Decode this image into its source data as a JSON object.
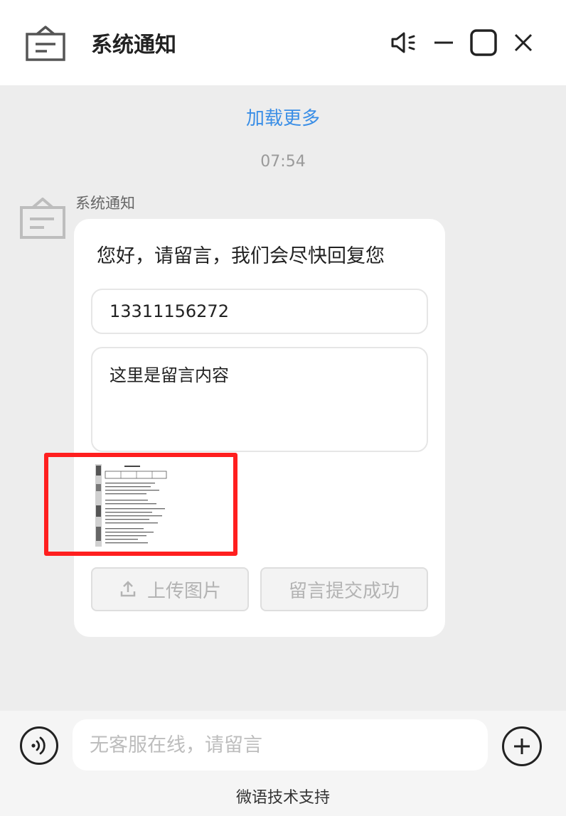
{
  "header": {
    "title": "系统通知",
    "app_icon": "tray-icon",
    "controls": [
      "sound-icon",
      "minimize-icon",
      "maximize-icon",
      "close-icon"
    ]
  },
  "chat": {
    "load_more": "加载更多",
    "timestamp": "07:54",
    "message": {
      "sender": "系统通知",
      "greeting": "您好，请留言，我们会尽快回复您",
      "phone_value": "13311156272",
      "content_value": "这里是留言内容",
      "upload_button": "上传图片",
      "submit_button": "留言提交成功"
    }
  },
  "footer": {
    "input_placeholder": "无客服在线，请留言",
    "powered_by": "微语技术支持"
  },
  "colors": {
    "accent": "#3a8ee6",
    "highlight": "#ff1f1f",
    "background": "#ededed"
  }
}
